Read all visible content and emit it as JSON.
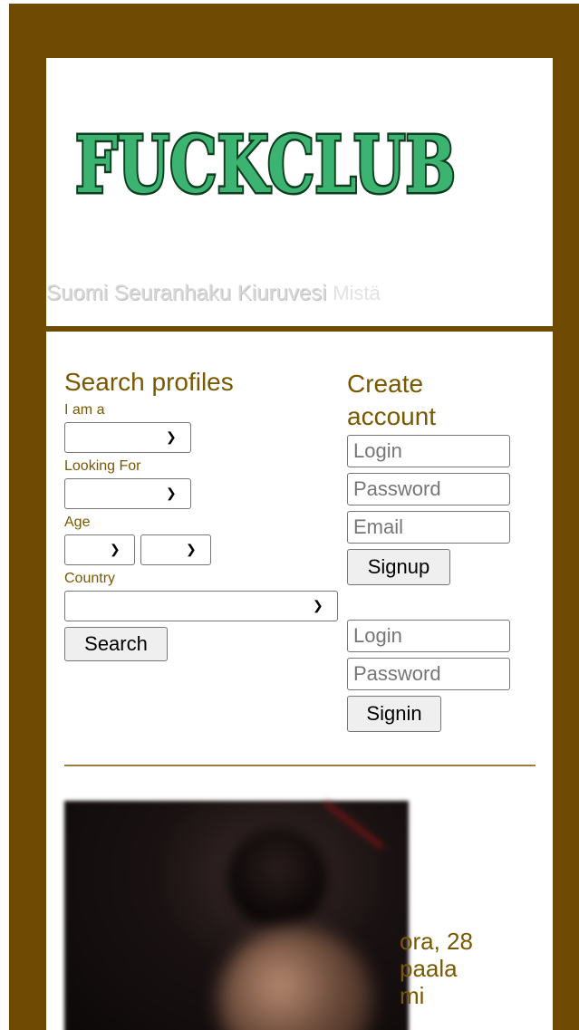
{
  "brand": {
    "logo_text": "FUCKCLUB",
    "logo_color": "#3cb371",
    "outline_color": "#0f3d1f"
  },
  "header": {
    "tagline": "Suomi Seuranhaku Kiuruvesi",
    "tagline_suffix": "Mistä"
  },
  "search": {
    "title": "Search profiles",
    "iam_label": "I am a",
    "looking_label": "Looking For",
    "age_label": "Age",
    "country_label": "Country",
    "button": "Search"
  },
  "create": {
    "title": "Create account",
    "login_placeholder": "Login",
    "password_placeholder": "Password",
    "email_placeholder": "Email",
    "signup_button": "Signup"
  },
  "signin": {
    "login_placeholder": "Login",
    "password_placeholder": "Password",
    "button": "Signin"
  },
  "profile": {
    "line1": "ora, 28",
    "line2": "paala",
    "line3": "mi"
  },
  "colors": {
    "frame": "#6e4a03",
    "accent_text": "#7a5800"
  }
}
